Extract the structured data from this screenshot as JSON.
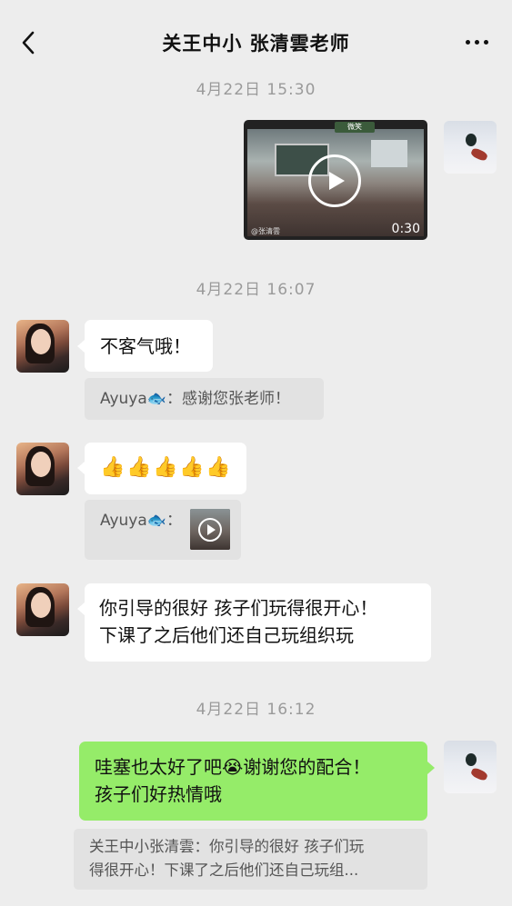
{
  "header": {
    "title": "关王中小 张清雲老师",
    "back_icon": "chevron-left-icon",
    "more_icon": "more-dots-icon"
  },
  "messages": {
    "time1": "4月22日 15:30",
    "video1": {
      "duration": "0:30",
      "badge": "微笑",
      "user": "@张清雲"
    },
    "time2": "4月22日 16:07",
    "msg1": {
      "text": "不客气哦！",
      "quote": "Ayuya🐟：感谢您张老师！"
    },
    "msg2": {
      "emojis": [
        "👍",
        "👍",
        "👍",
        "👍",
        "👍"
      ],
      "quote": "Ayuya🐟："
    },
    "msg3": {
      "line1": "你引导的很好 孩子们玩得很开心！",
      "line2": "下课了之后他们还自己玩组织玩"
    },
    "time3": "4月22日 16:12",
    "msg4": {
      "line1_a": "哇塞也太好了吧",
      "emoji": "😭",
      "line1_b": "谢谢您的配合！",
      "line2": "孩子们好热情哦",
      "quote_line1": "关王中小张清雲：你引导的很好 孩子们玩",
      "quote_line2": "得很开心！下课了之后他们还自己玩组..."
    }
  },
  "colors": {
    "background": "#ededed",
    "bubble_sent": "#95ec69",
    "bubble_received": "#ffffff",
    "quote_bg": "#e2e2e2"
  }
}
